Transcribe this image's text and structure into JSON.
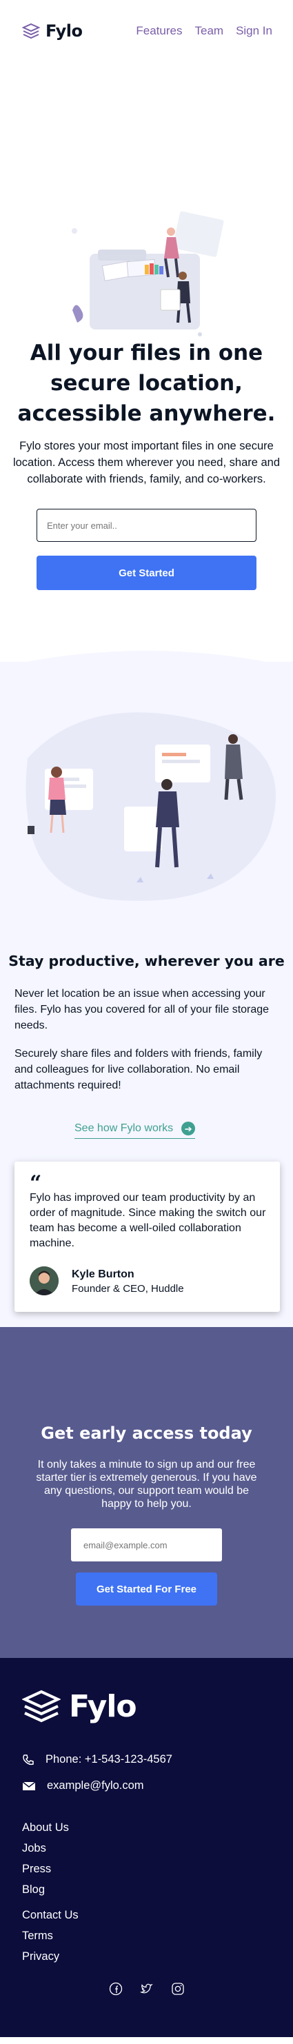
{
  "header": {
    "logo_text": "Fylo",
    "nav": [
      {
        "label": "Features"
      },
      {
        "label": "Team"
      },
      {
        "label": "Sign In"
      }
    ]
  },
  "hero": {
    "title": "All your files in one secure location, accessible anywhere.",
    "subtitle": "Fylo stores your most important files in one secure location. Access them wherever you need, share and collaborate with friends, family, and co-workers.",
    "email_placeholder": "Enter your email..",
    "cta_label": "Get Started"
  },
  "productive": {
    "title": "Stay productive, wherever you are",
    "paragraph1": "Never let location be an issue when accessing your files. Fylo has you covered for all of your file storage needs.",
    "paragraph2": "Securely share files and folders with friends, family and colleagues for live collaboration. No email attachments required!",
    "link_label": "See how Fylo works",
    "link_icon": "arrow-right-icon"
  },
  "testimonial": {
    "quote": "Fylo has improved our team productivity by an order of magnitude. Since making the switch our team has become a well-oiled collaboration machine.",
    "name": "Kyle Burton",
    "role": "Founder & CEO, Huddle"
  },
  "early_access": {
    "title": "Get early access today",
    "text": "It only takes a minute to sign up and our free starter tier is extremely generous. If you have any questions, our support team would be happy to help you.",
    "email_placeholder": "email@example.com",
    "cta_label": "Get Started For Free"
  },
  "footer": {
    "logo_text": "Fylo",
    "phone": "Phone: +1-543-123-4567",
    "email": "example@fylo.com",
    "links_group1": [
      {
        "label": "About Us"
      },
      {
        "label": "Jobs"
      },
      {
        "label": "Press"
      },
      {
        "label": "Blog"
      }
    ],
    "links_group2": [
      {
        "label": "Contact Us"
      },
      {
        "label": "Terms"
      },
      {
        "label": "Privacy"
      }
    ],
    "social": [
      "facebook-icon",
      "twitter-icon",
      "instagram-icon"
    ]
  },
  "colors": {
    "accent_blue": "#3f73f4",
    "nav_purple": "#7a5ea8",
    "teal_link": "#3fa091",
    "early_bg": "#585b8e",
    "footer_bg": "#0c0d3b",
    "section_bg": "#f5f6ff"
  }
}
